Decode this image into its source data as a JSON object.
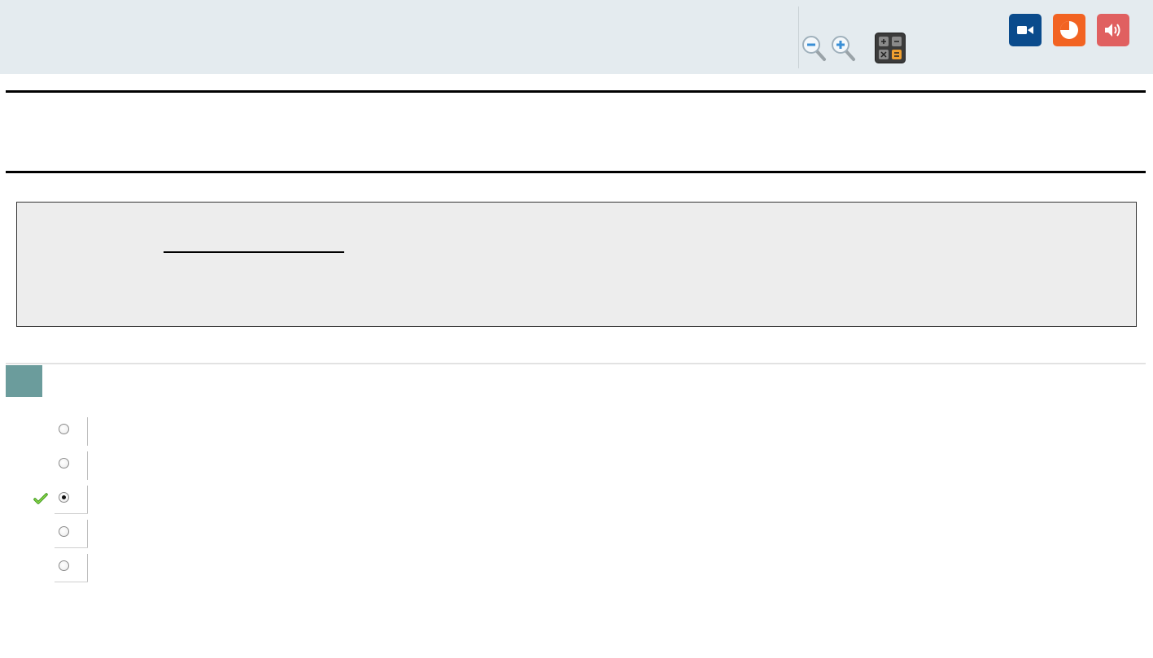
{
  "toolbar": {
    "icons": {
      "zoom_out": "zoom-out-icon",
      "zoom_in": "zoom-in-icon",
      "calculator": "calculator-icon",
      "video": "video-icon",
      "timer": "pie-timer-icon",
      "audio": "speaker-icon"
    },
    "colors": {
      "background": "#e4ebef",
      "video_button": "#0a4b8c",
      "timer_button": "#f26322",
      "audio_button": "#e06060"
    }
  },
  "question": {
    "number_badge_color": "#6b9c9c",
    "options": [
      {
        "selected": false,
        "marked_correct": false
      },
      {
        "selected": false,
        "marked_correct": false
      },
      {
        "selected": true,
        "marked_correct": true
      },
      {
        "selected": false,
        "marked_correct": false
      },
      {
        "selected": false,
        "marked_correct": false
      }
    ]
  }
}
